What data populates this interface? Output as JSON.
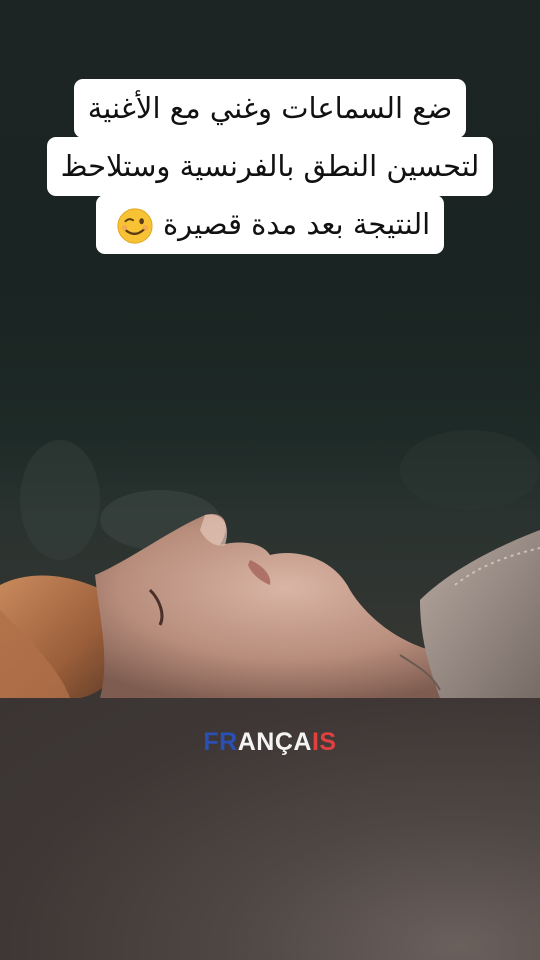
{
  "caption": {
    "lines": [
      "ضع السماعات وغني مع الأغنية",
      "لتحسين النطق بالفرنسية وستلاحظ",
      "النتيجة بعد مدة قصيرة"
    ],
    "emoji": "wink-emoji"
  },
  "brand": {
    "part1": "FR",
    "part2": "ANÇA",
    "part3": "IS",
    "colors": {
      "blue": "#2a4fb5",
      "white": "#f4f4f4",
      "red": "#e0403f"
    }
  },
  "photo": {
    "subject": "woman-lying-face-up-eyes-closed"
  }
}
